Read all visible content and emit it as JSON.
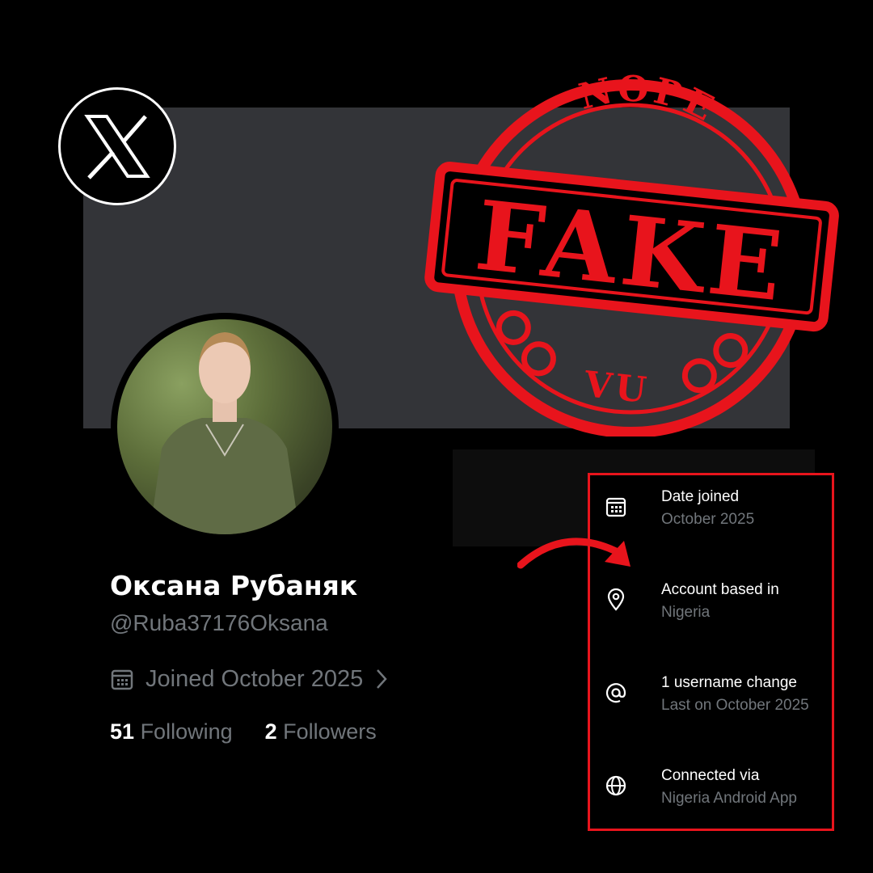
{
  "banner": {
    "color": "#333438"
  },
  "logo": {
    "icon": "x-logo-icon"
  },
  "stamp": {
    "top_text": "NOPE",
    "main_text": "FAKE",
    "bottom_text": "VU",
    "color": "#e8141c"
  },
  "profile": {
    "display_name": "Оксана Рубаняк",
    "handle": "@Ruba37176Oksana",
    "joined": "Joined October 2025",
    "following_count": "51",
    "following_label": "Following",
    "followers_count": "2",
    "followers_label": "Followers"
  },
  "about": {
    "highlight_color": "#e8141c",
    "rows": [
      {
        "icon": "calendar-icon",
        "label": "Date joined",
        "value": "October 2025"
      },
      {
        "icon": "location-pin-icon",
        "label": "Account based in",
        "value": "Nigeria"
      },
      {
        "icon": "at-sign-icon",
        "label": "1 username change",
        "value": "Last on October 2025"
      },
      {
        "icon": "globe-icon",
        "label": "Connected via",
        "value": "Nigeria Android App"
      }
    ]
  }
}
